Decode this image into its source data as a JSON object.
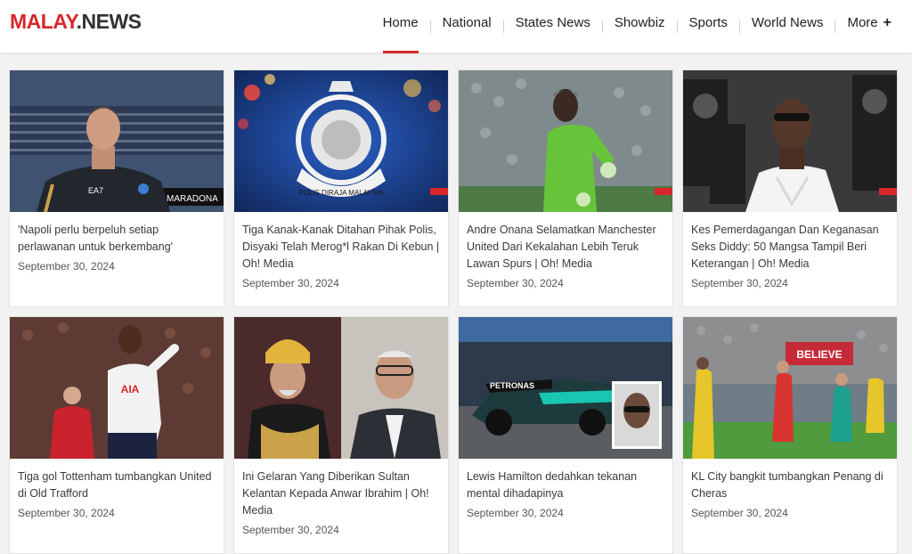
{
  "site": {
    "brand": "MALAY",
    "tld": ".NEWS"
  },
  "nav": {
    "items": [
      "Home",
      "National",
      "States News",
      "Showbiz",
      "Sports",
      "World News",
      "More"
    ],
    "more_icon": "plus-icon",
    "accent": "#d9262a"
  },
  "articles": [
    {
      "title": "'Napoli perlu berpeluh setiap perlawanan untuk berkembang'",
      "date": "September 30, 2024",
      "image_text": "MARADONA"
    },
    {
      "title": "Tiga Kanak-Kanak Ditahan Pihak Polis, Disyaki Telah Merog*l Rakan Di Kebun | Oh! Media",
      "date": "September 30, 2024",
      "image_text": "POLIS DIRAJA MALAYSIA"
    },
    {
      "title": "Andre Onana Selamatkan Manchester United Dari Kekalahan Lebih Teruk Lawan Spurs | Oh! Media",
      "date": "September 30, 2024",
      "image_text": ""
    },
    {
      "title": "Kes Pemerdagangan Dan Keganasan Seks Diddy: 50 Mangsa Tampil Beri Keterangan | Oh! Media",
      "date": "September 30, 2024",
      "image_text": ""
    },
    {
      "title": "Tiga gol Tottenham tumbangkan United di Old Trafford",
      "date": "September 30, 2024",
      "image_text": "AIA"
    },
    {
      "title": "Ini Gelaran Yang Diberikan Sultan Kelantan Kepada Anwar Ibrahim | Oh! Media",
      "date": "September 30, 2024",
      "image_text": ""
    },
    {
      "title": "Lewis Hamilton dedahkan tekanan mental dihadapinya",
      "date": "September 30, 2024",
      "image_text": "PETRONAS"
    },
    {
      "title": "KL City bangkit tumbangkan Penang di Cheras",
      "date": "September 30, 2024",
      "image_text": "BELIEVE"
    }
  ]
}
